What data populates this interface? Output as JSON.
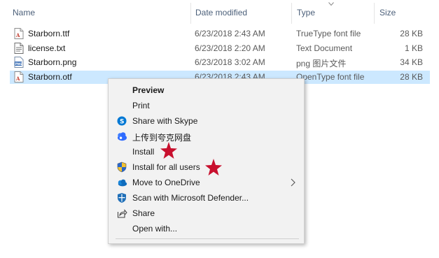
{
  "columns": {
    "name": "Name",
    "date": "Date modified",
    "type": "Type",
    "size": "Size"
  },
  "files": [
    {
      "name": "Starborn.ttf",
      "date": "6/23/2018 2:43 AM",
      "type": "TrueType font file",
      "size": "28 KB",
      "icon": "font-file-icon"
    },
    {
      "name": "license.txt",
      "date": "6/23/2018 2:20 AM",
      "type": "Text Document",
      "size": "1 KB",
      "icon": "text-file-icon"
    },
    {
      "name": "Starborn.png",
      "date": "6/23/2018 3:02 AM",
      "type": "png 图片文件",
      "size": "34 KB",
      "icon": "image-file-icon"
    },
    {
      "name": "Starborn.otf",
      "date": "6/23/2018 2:43 AM",
      "type": "OpenType font file",
      "size": "28 KB",
      "icon": "font-file-icon",
      "selected": true
    }
  ],
  "context_menu": {
    "items": [
      {
        "label": "Preview",
        "bold": true
      },
      {
        "label": "Print"
      },
      {
        "label": "Share with Skype",
        "icon": "skype-icon"
      },
      {
        "label": "上传到夸克网盘",
        "icon": "quark-cloud-icon"
      },
      {
        "label": "Install",
        "annotated": true
      },
      {
        "label": "Install for all users",
        "icon": "admin-shield-icon",
        "annotated": true
      },
      {
        "label": "Move to OneDrive",
        "icon": "onedrive-icon",
        "submenu": true
      },
      {
        "label": "Scan with Microsoft Defender...",
        "icon": "defender-icon"
      },
      {
        "label": "Share",
        "icon": "share-icon"
      },
      {
        "label": "Open with..."
      }
    ]
  },
  "colors": {
    "selection": "#cce8ff",
    "menu_bg": "#f2f2f2",
    "annotation_star": "#c8102e"
  }
}
